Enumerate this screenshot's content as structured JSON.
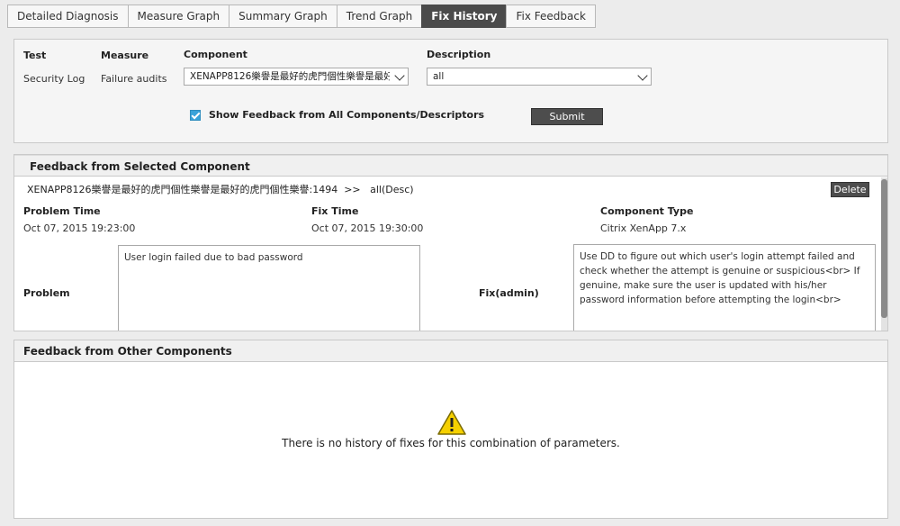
{
  "tabs": [
    {
      "label": "Detailed Diagnosis"
    },
    {
      "label": "Measure Graph"
    },
    {
      "label": "Summary Graph"
    },
    {
      "label": "Trend Graph"
    },
    {
      "label": "Fix History",
      "active": true
    },
    {
      "label": "Fix Feedback"
    }
  ],
  "filter": {
    "test_label": "Test",
    "test_value": "Security Log",
    "measure_label": "Measure",
    "measure_value": "Failure audits",
    "component_label": "Component",
    "component_value": "XENAPP8126樂譽是最好的虎門個性樂譽是最好的虎門個性樂譽:1494",
    "description_label": "Description",
    "description_value": "all",
    "show_all_label": "Show Feedback from All Components/Descriptors",
    "show_all_checked": true,
    "submit_label": "Submit"
  },
  "selected": {
    "title": "Feedback from Selected Component",
    "component_line": "XENAPP8126樂譽是最好的虎門個性樂譽是最好的虎門個性樂譽:1494  >>   all(Desc)",
    "delete_label": "Delete",
    "problem_time_label": "Problem Time",
    "problem_time_value": "Oct 07, 2015 19:23:00",
    "fix_time_label": "Fix Time",
    "fix_time_value": "Oct 07, 2015 19:30:00",
    "component_type_label": "Component Type",
    "component_type_value": "Citrix XenApp 7.x",
    "problem_label": "Problem",
    "problem_text": "User login failed due to bad password",
    "fix_label": "Fix(admin)",
    "fix_text": "Use DD to figure out which user's login attempt failed and check whether the attempt is genuine or suspicious<br> If genuine, make sure the user is updated with his/her password information before attempting the login<br>"
  },
  "other": {
    "title": "Feedback from Other Components",
    "empty_message": "There is no history of fixes for this combination of parameters."
  },
  "colors": {
    "active_tab": "#4b4b4b",
    "checkbox": "#3aa3d9",
    "warning": "#f5d000"
  }
}
